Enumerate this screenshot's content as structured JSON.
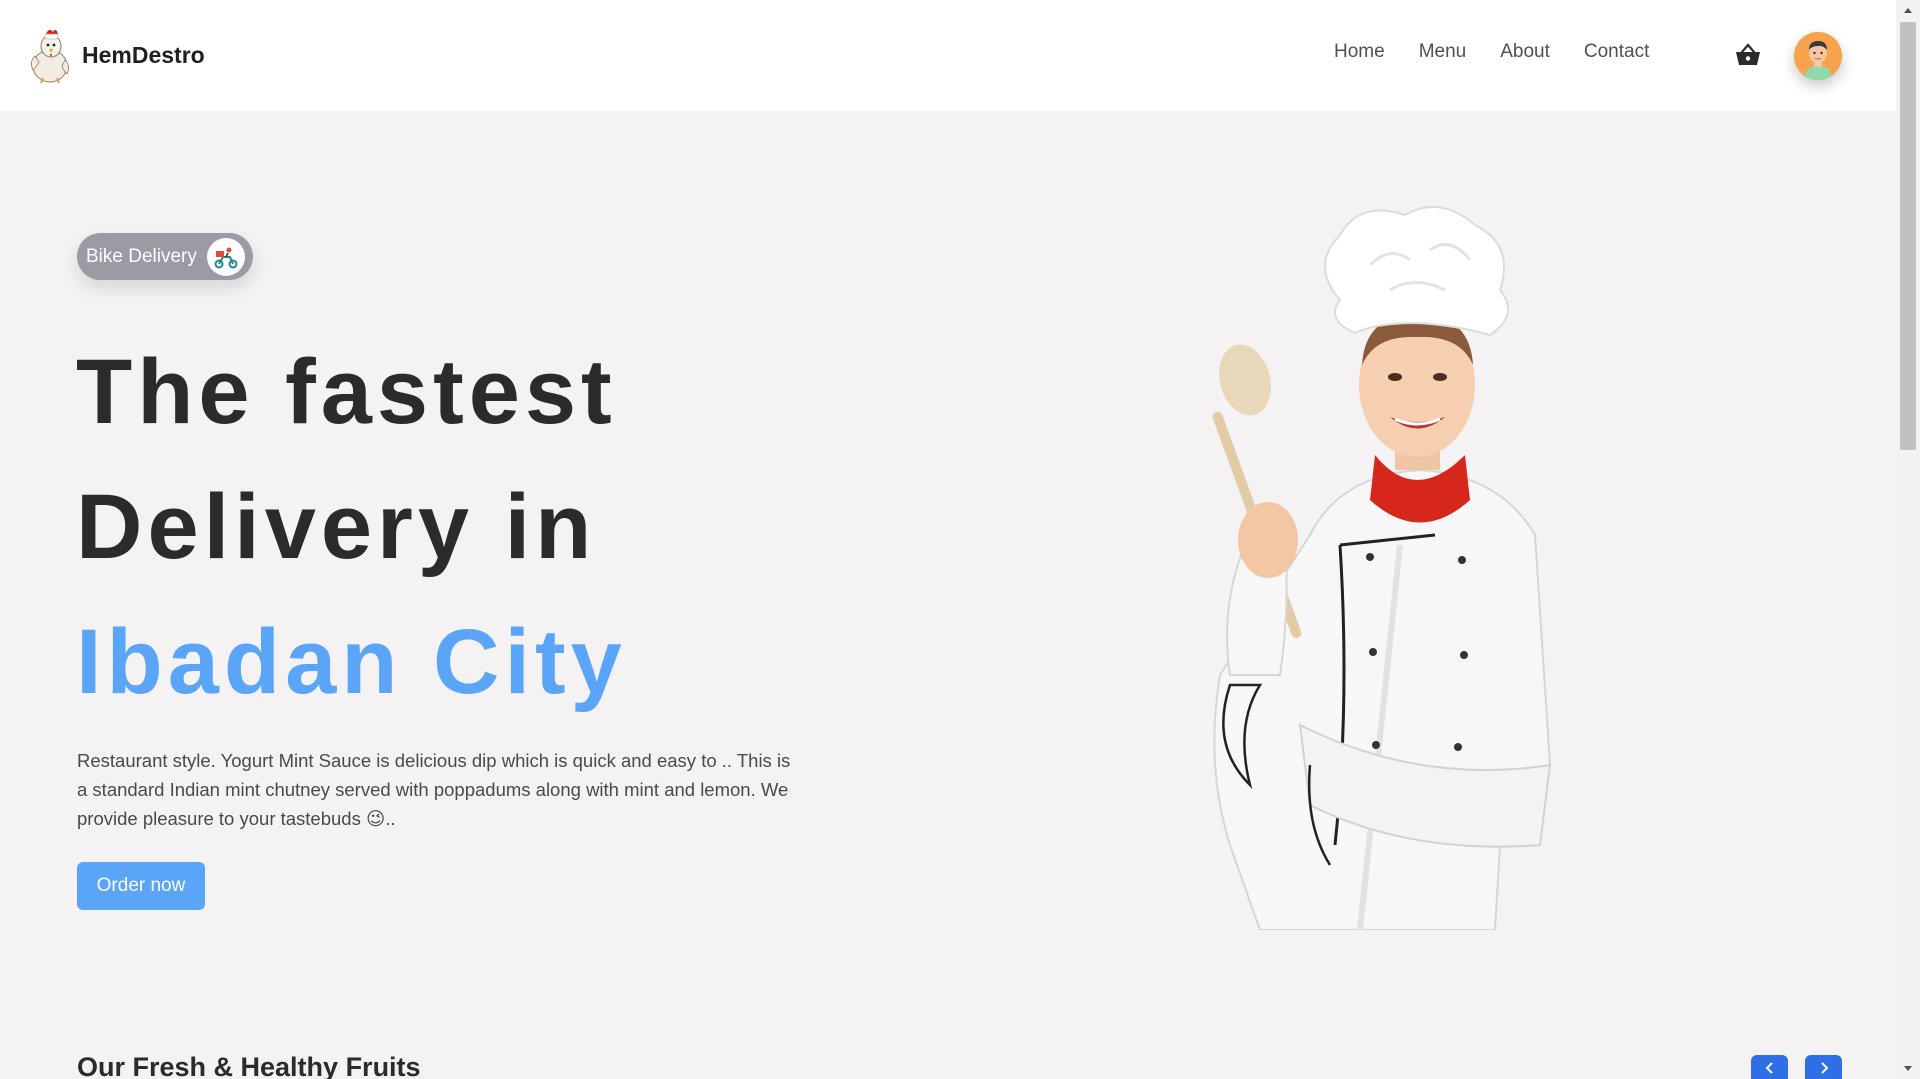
{
  "brand": {
    "name": "HemDestro",
    "logo_icon": "rooster-chef-logo-icon"
  },
  "nav": {
    "items": [
      {
        "label": "Home"
      },
      {
        "label": "Menu"
      },
      {
        "label": "About"
      },
      {
        "label": "Contact"
      }
    ],
    "cart_icon": "basket-icon",
    "avatar_icon": "user-avatar-icon"
  },
  "hero": {
    "badge": {
      "label": "Bike Delivery",
      "icon": "delivery-scooter-icon"
    },
    "title_line1": "The fastest",
    "title_line2": "Delivery in",
    "title_accent": "Ibadan City",
    "description": "Restaurant style. Yogurt Mint Sauce is delicious dip which is quick and easy to .. This is a standard Indian mint chutney served with poppadums along with mint and lemon. We provide pleasure to your tastebuds 😉..",
    "cta": "Order now",
    "image": "chef-holding-wooden-spoon"
  },
  "fruits_section": {
    "title": "Our Fresh & Healthy Fruits",
    "prev_icon": "chevron-left-icon",
    "next_icon": "chevron-right-icon"
  },
  "colors": {
    "accent": "#5aa5f7",
    "arrow_button": "#2e6fe8",
    "background": "#f4f2f3",
    "header": "#ffffff",
    "avatar": "#f7a24c",
    "badge": "#9a9ba5"
  }
}
